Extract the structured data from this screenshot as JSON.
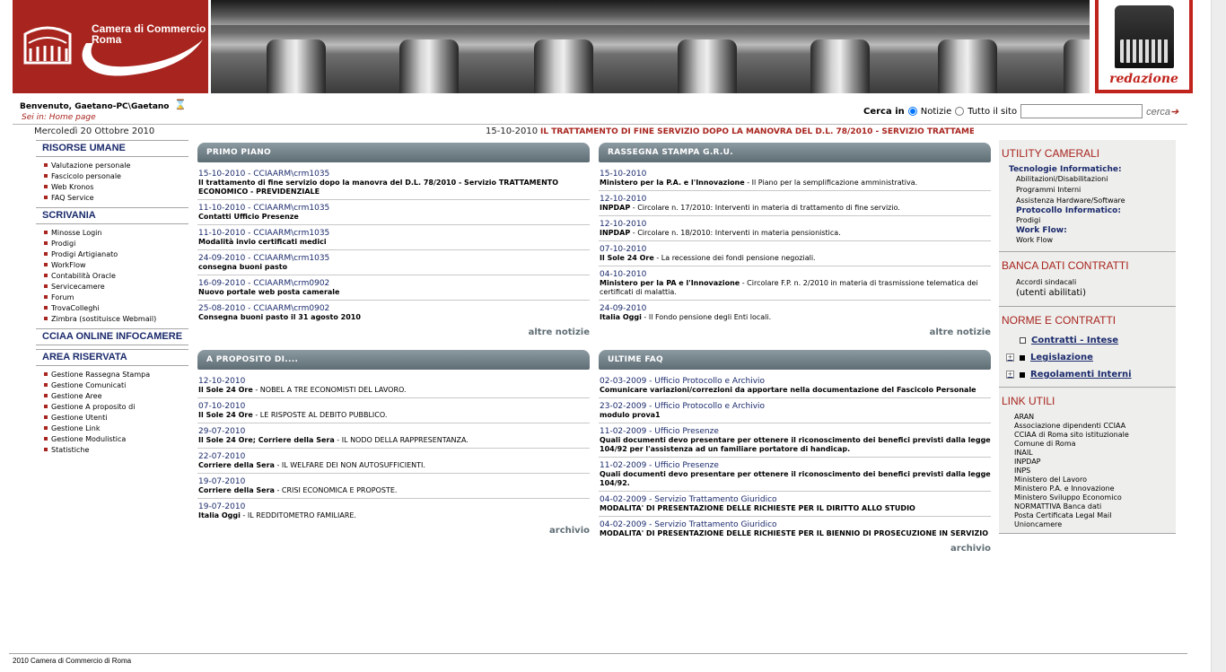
{
  "header": {
    "logo_line1": "Camera di Commercio",
    "logo_line2": "Roma",
    "redazione_label": "redazione"
  },
  "welcome": {
    "text": "Benvenuto, Gaetano-PC\\Gaetano",
    "sei_in": "Sei in: Home page"
  },
  "search": {
    "label": "Cerca in",
    "option1": "Notizie",
    "option2": "Tutto il sito",
    "button": "cerca"
  },
  "date": "Mercoledì 20 Ottobre 2010",
  "ticker": {
    "date": "15-10-2010",
    "text": "IL TRATTAMENTO DI FINE SERVIZIO DOPO LA MANOVRA DEL D.L. 78/2010 - SERVIZIO TRATTAMENTO ECONOMICO - PREVIDENZIALE"
  },
  "nav": [
    {
      "title": "RISORSE UMANE",
      "items": [
        "Valutazione personale",
        "Fascicolo personale",
        "Web Kronos",
        "FAQ Service"
      ]
    },
    {
      "title": "SCRIVANIA",
      "items": [
        "Minosse Login",
        "Prodigi",
        "Prodigi Artigianato",
        "WorkFlow",
        "Contabilità Oracle",
        "Servicecamere",
        "Forum",
        "TrovaColleghi",
        "Zimbra (sostituisce Webmail)"
      ]
    },
    {
      "title": "CCIAA ONLINE INFOCAMERE",
      "items": []
    },
    {
      "title": "AREA RISERVATA",
      "items": [
        "Gestione Rassegna Stampa",
        "Gestione Comunicati",
        "Gestione Aree",
        "Gestione A proposito di",
        "Gestione Utenti",
        "Gestione Link",
        "Gestione Modulistica",
        "Statistiche"
      ]
    }
  ],
  "primo_piano": {
    "title": "PRIMO PIANO",
    "more": "altre notizie",
    "items": [
      {
        "date": "15-10-2010 - CCIAARM\\crm1035",
        "text": "Il trattamento di fine servizio dopo la manovra del D.L. 78/2010 - Servizio TRATTAMENTO ECONOMICO - PREVIDENZIALE"
      },
      {
        "date": "11-10-2010 - CCIAARM\\crm1035",
        "text": "Contatti Ufficio Presenze"
      },
      {
        "date": "11-10-2010 - CCIAARM\\crm1035",
        "text": "Modalità invio certificati medici"
      },
      {
        "date": "24-09-2010 - CCIAARM\\crm1035",
        "text": "consegna buoni pasto"
      },
      {
        "date": "16-09-2010 - CCIAARM\\crm0902",
        "text": "Nuovo portale web posta camerale"
      },
      {
        "date": "25-08-2010 - CCIAARM\\crm0902",
        "text": "Consegna buoni pasto il 31 agosto 2010"
      }
    ]
  },
  "rassegna": {
    "title": "RASSEGNA STAMPA G.R.U.",
    "more": "altre notizie",
    "items": [
      {
        "date": "15-10-2010",
        "source": "Ministero per la P.A. e l'Innovazione",
        "text": " - Il Piano per la semplificazione amministrativa."
      },
      {
        "date": "12-10-2010",
        "source": "INPDAP",
        "text": " - Circolare n. 17/2010: Interventi in materia di trattamento di fine servizio."
      },
      {
        "date": "12-10-2010",
        "source": "INPDAP",
        "text": " - Circolare n. 18/2010: Interventi in materia pensionistica."
      },
      {
        "date": "07-10-2010",
        "source": "Il Sole 24 Ore",
        "text": " - La recessione dei fondi pensione negoziali."
      },
      {
        "date": "04-10-2010",
        "source": "Ministero per la PA e l'Innovazione",
        "text": " - Circolare F.P. n. 2/2010 in materia di trasmissione telematica dei certificati di malattia."
      },
      {
        "date": "24-09-2010",
        "source": "Italia Oggi",
        "text": " - Il Fondo pensione degli Enti locali."
      }
    ]
  },
  "a_proposito": {
    "title": "A PROPOSITO DI....",
    "more": "archivio",
    "items": [
      {
        "date": "12-10-2010",
        "source": "Il Sole 24 Ore",
        "text": " - NOBEL A TRE ECONOMISTI DEL LAVORO."
      },
      {
        "date": "07-10-2010",
        "source": "Il Sole 24 Ore",
        "text": " - LE RISPOSTE AL DEBITO PUBBLICO."
      },
      {
        "date": "29-07-2010",
        "source": "Il Sole 24 Ore; Corriere della Sera",
        "text": " - IL NODO DELLA RAPPRESENTANZA."
      },
      {
        "date": "22-07-2010",
        "source": "Corriere della Sera",
        "text": " - IL WELFARE DEI NON AUTOSUFFICIENTI."
      },
      {
        "date": "19-07-2010",
        "source": "Corriere della Sera",
        "text": " - CRISI ECONOMICA E PROPOSTE."
      },
      {
        "date": "19-07-2010",
        "source": "Italia Oggi",
        "text": " - IL REDDITOMETRO FAMILIARE."
      }
    ]
  },
  "faq": {
    "title": "ULTIME FAQ",
    "more": "archivio",
    "items": [
      {
        "date": "02-03-2009 - Ufficio Protocollo e Archivio",
        "text": "Comunicare variazioni/correzioni da apportare nella documentazione del Fascicolo Personale"
      },
      {
        "date": "23-02-2009 - Ufficio Protocollo e Archivio",
        "text": "modulo prova1"
      },
      {
        "date": "11-02-2009 - Ufficio Presenze",
        "text": "Quali documenti devo presentare per ottenere il riconoscimento dei benefici previsti dalla legge 104/92 per l'assistenza ad un familiare portatore di handicap."
      },
      {
        "date": "11-02-2009 - Ufficio Presenze",
        "text": "Quali documenti devo presentare per ottenere il riconoscimento dei benefici previsti dalla legge 104/92."
      },
      {
        "date": "04-02-2009 - Servizio Trattamento Giuridico",
        "text": "MODALITA' DI PRESENTAZIONE DELLE RICHIESTE PER IL DIRITTO ALLO STUDIO"
      },
      {
        "date": "04-02-2009 - Servizio Trattamento Giuridico",
        "text": "MODALITA' DI PRESENTAZIONE DELLE RICHIESTE PER IL BIENNIO DI PROSECUZIONE IN SERVIZIO"
      }
    ]
  },
  "right": {
    "utility_title": "UTILITY CAMERALI",
    "tecno_title": "Tecnologie Informatiche:",
    "tecno_items": [
      "Abilitazioni/Disabilitazioni",
      "Programmi Interni",
      "Assistenza Hardware/Software"
    ],
    "protocollo_title": "Protocollo Informatico:",
    "protocollo_items": [
      "Prodigi"
    ],
    "workflow_title": "Work Flow:",
    "workflow_items": [
      "Work Flow"
    ],
    "banca_title": "BANCA DATI CONTRATTI",
    "banca_item1": "Accordi sindacali",
    "banca_item2": "(utenti abilitati)",
    "norme_title": "NORME E CONTRATTI",
    "norme_items": [
      "Contratti - Intese",
      "Legislazione",
      "Regolamenti Interni"
    ],
    "link_title": "LINK UTILI",
    "links": [
      "ARAN",
      "Associazione dipendenti CCIAA",
      "CCIAA di Roma sito istituzionale",
      "Comune di Roma",
      "INAIL",
      "INPDAP",
      "INPS",
      "Ministero del Lavoro",
      "Ministero P.A. e Innovazione",
      "Ministero Sviluppo Economico",
      "NORMATTIVA Banca dati",
      "Posta Certificata Legal Mail",
      "Unioncamere"
    ]
  },
  "footer": "2010 Camera di Commercio di Roma"
}
